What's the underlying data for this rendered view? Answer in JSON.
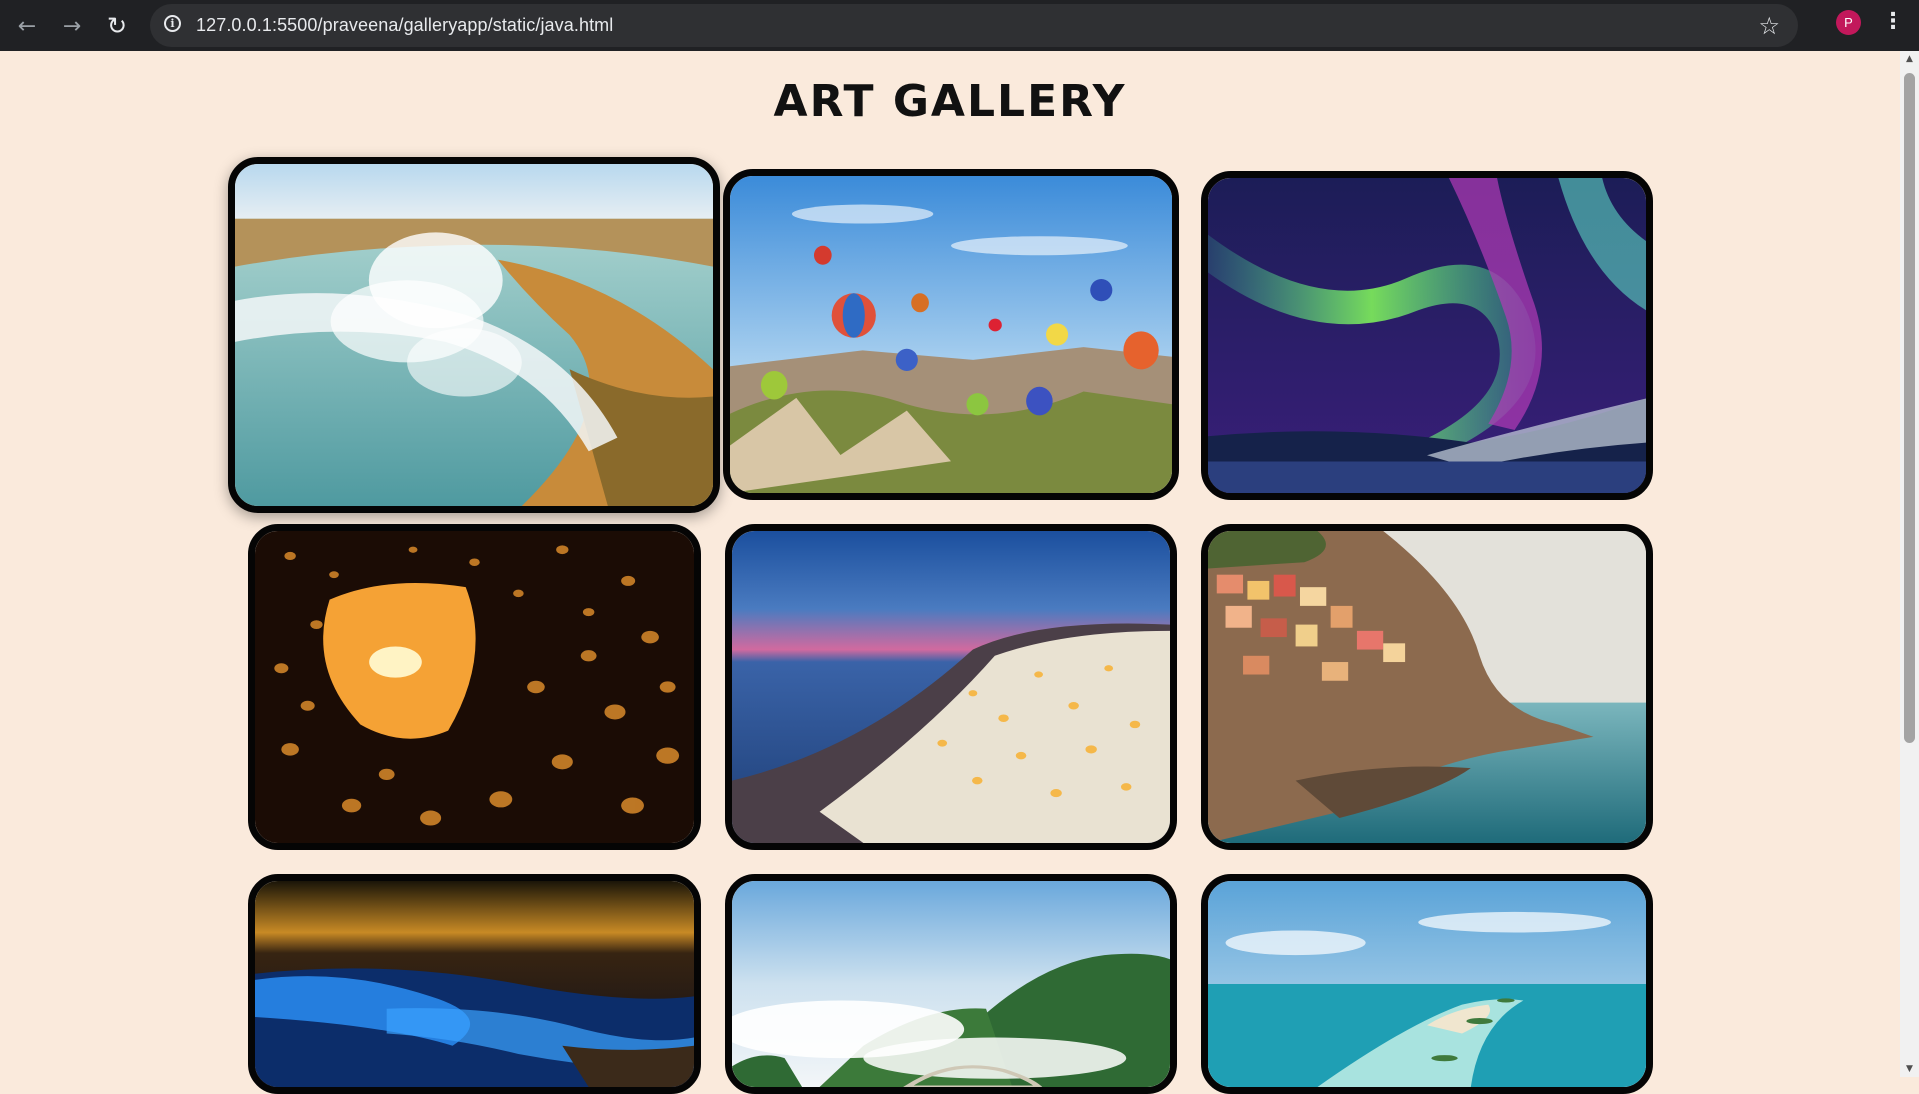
{
  "browser": {
    "url": "127.0.0.1:5500/praveena/galleryapp/static/java.html",
    "back_icon": "arrow-left-icon",
    "forward_icon": "arrow-right-icon",
    "reload_icon": "reload-icon",
    "bookmark_icon": "star-icon",
    "profile_initial": "P"
  },
  "page": {
    "title": "ART GALLERY"
  },
  "gallery": {
    "images": [
      {
        "subject": "waterfall"
      },
      {
        "subject": "hot-air-balloons"
      },
      {
        "subject": "aurora"
      },
      {
        "subject": "sky-lanterns"
      },
      {
        "subject": "cliffside-village-night"
      },
      {
        "subject": "cliffside-village-sea"
      },
      {
        "subject": "glowing-beach"
      },
      {
        "subject": "misty-mountains"
      },
      {
        "subject": "tropical-islands"
      }
    ]
  },
  "colors": {
    "page_background": "#faeadc",
    "card_border": "#050505",
    "chrome_background": "#202124"
  }
}
